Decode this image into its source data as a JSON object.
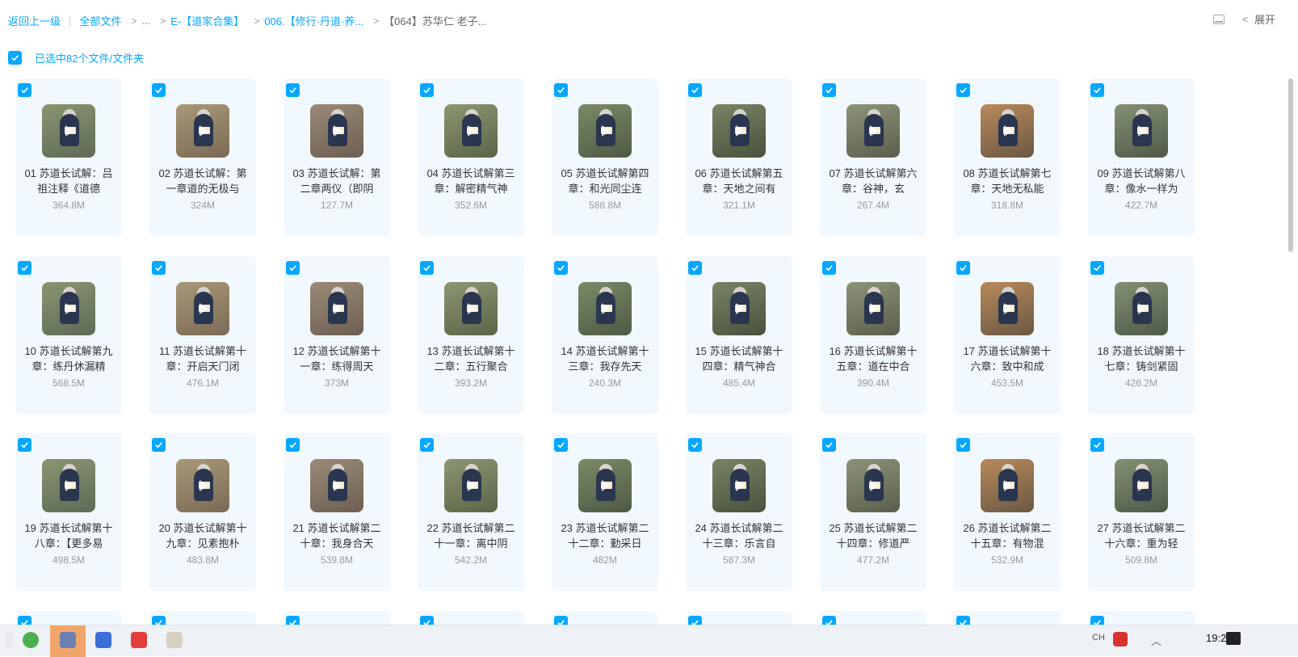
{
  "breadcrumb": {
    "back": "返回上一级",
    "all_files": "全部文件",
    "ellipsis": "...",
    "level1": "E-【道家合集】",
    "level2": "006.【修行·丹道·养...",
    "current": "【064】苏华仁 老子..."
  },
  "header": {
    "expand_label": "展开"
  },
  "selection": {
    "text": "已选中82个文件/文件夹"
  },
  "colors": {
    "accent": "#06a7ff",
    "card_bg": "#f2f9fe"
  },
  "files": [
    {
      "name": "01 苏道长试解：吕祖注释《道德",
      "size": "364.8M"
    },
    {
      "name": "02 苏道长试解：第一章道的无极与",
      "size": "324M"
    },
    {
      "name": "03 苏道长试解：第二章两仪（即阴",
      "size": "127.7M"
    },
    {
      "name": "04 苏道长试解第三章：解密精气神",
      "size": "352.6M"
    },
    {
      "name": "05 苏道长试解第四章：和光同尘连",
      "size": "588.8M"
    },
    {
      "name": "06 苏道长试解第五章：天地之间有",
      "size": "321.1M"
    },
    {
      "name": "07 苏道长试解第六章：谷神，玄",
      "size": "267.4M"
    },
    {
      "name": "08 苏道长试解第七章：天地无私能",
      "size": "318.8M"
    },
    {
      "name": "09 苏道长试解第八章：像水一样为",
      "size": "422.7M"
    },
    {
      "name": "10 苏道长试解第九章：练丹休漏精",
      "size": "568.5M"
    },
    {
      "name": "11 苏道长试解第十章：开启天门闭",
      "size": "476.1M"
    },
    {
      "name": "12 苏道长试解第十一章：练得周天",
      "size": "373M"
    },
    {
      "name": "13 苏道长试解第十二章：五行聚合",
      "size": "393.2M"
    },
    {
      "name": "14 苏道长试解第十三章：我存先天",
      "size": "240.3M"
    },
    {
      "name": "15 苏道长试解第十四章：精气神合",
      "size": "485.4M"
    },
    {
      "name": "16 苏道长试解第十五章：道在中合",
      "size": "390.4M"
    },
    {
      "name": "17 苏道长试解第十六章：致中和成",
      "size": "453.5M"
    },
    {
      "name": "18 苏道长试解第十七章：铸剑紧固",
      "size": "426.2M"
    },
    {
      "name": "19 苏道长试解第十八章：【更多易",
      "size": "498.5M"
    },
    {
      "name": "20 苏道长试解第十九章：见素抱朴",
      "size": "483.8M"
    },
    {
      "name": "21 苏道长试解第二十章：我身合天",
      "size": "539.8M"
    },
    {
      "name": "22 苏道长试解第二十一章：离中阴",
      "size": "542.2M"
    },
    {
      "name": "23 苏道长试解第二十二章：勤采日",
      "size": "482M"
    },
    {
      "name": "24 苏道长试解第二十三章：乐言自",
      "size": "587.3M"
    },
    {
      "name": "25 苏道长试解第二十四章：修道严",
      "size": "477.2M"
    },
    {
      "name": "26 苏道长试解第二十五章：有物混",
      "size": "532.9M"
    },
    {
      "name": "27 苏道长试解第二十六章：重为轻",
      "size": "509.8M"
    }
  ],
  "taskbar": {
    "time": "19:20",
    "tray_lang": "CH"
  }
}
